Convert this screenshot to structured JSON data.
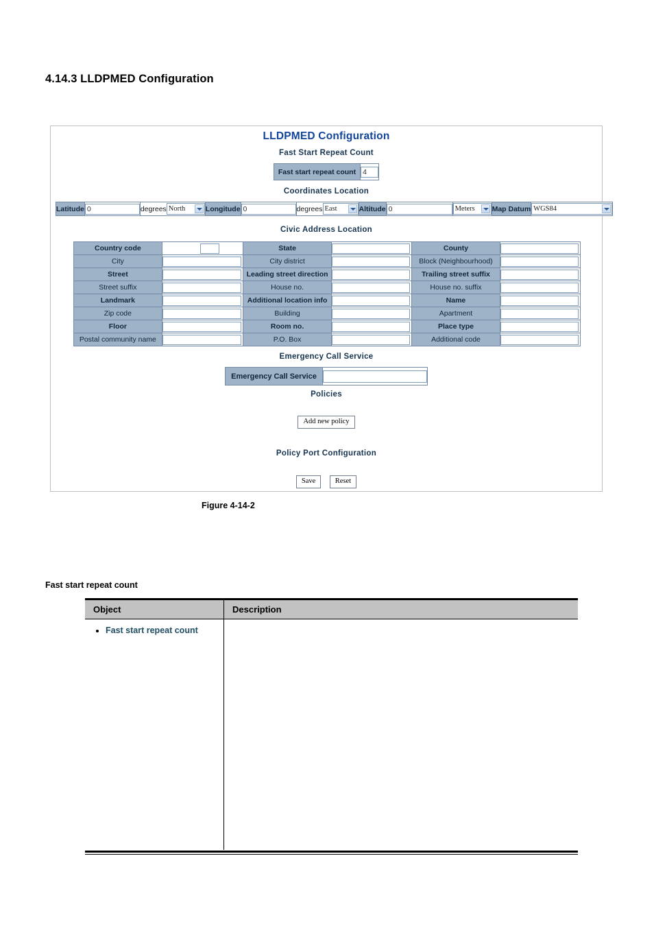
{
  "document": {
    "heading": "4.14.3 LLDPMED Configuration",
    "figure_caption": "Figure 4-14-2",
    "sub_heading": "Fast start repeat count"
  },
  "panel": {
    "title": "LLDPMED Configuration",
    "sections": {
      "fast_start": "Fast Start Repeat Count",
      "coordinates": "Coordinates Location",
      "civic": "Civic Address Location",
      "emergency": "Emergency Call Service",
      "policies": "Policies",
      "policy_port": "Policy Port Configuration"
    },
    "fast_start": {
      "label": "Fast start repeat count",
      "value": "4"
    },
    "coordinates": {
      "latitude_label": "Latitude",
      "latitude_value": "0",
      "latitude_units": "degrees",
      "latitude_direction": "North",
      "longitude_label": "Longitude",
      "longitude_value": "0",
      "longitude_units": "degrees",
      "longitude_direction": "East",
      "altitude_label": "Altitude",
      "altitude_value": "0",
      "altitude_units": "Meters",
      "map_datum_label": "Map Datum",
      "map_datum_value": "WGS84"
    },
    "civic_rows": [
      {
        "c1": "Country code",
        "v1": "",
        "c2": "State",
        "v2": "",
        "c3": "County",
        "v3": ""
      },
      {
        "c1": "City",
        "v1": "",
        "c2": "City district",
        "v2": "",
        "c3": "Block (Neighbourhood)",
        "v3": ""
      },
      {
        "c1": "Street",
        "v1": "",
        "c2": "Leading street direction",
        "v2": "",
        "c3": "Trailing street suffix",
        "v3": ""
      },
      {
        "c1": "Street suffix",
        "v1": "",
        "c2": "House no.",
        "v2": "",
        "c3": "House no. suffix",
        "v3": ""
      },
      {
        "c1": "Landmark",
        "v1": "",
        "c2": "Additional location info",
        "v2": "",
        "c3": "Name",
        "v3": ""
      },
      {
        "c1": "Zip code",
        "v1": "",
        "c2": "Building",
        "v2": "",
        "c3": "Apartment",
        "v3": ""
      },
      {
        "c1": "Floor",
        "v1": "",
        "c2": "Room no.",
        "v2": "",
        "c3": "Place type",
        "v3": ""
      },
      {
        "c1": "Postal community name",
        "v1": "",
        "c2": "P.O. Box",
        "v2": "",
        "c3": "Additional code",
        "v3": ""
      }
    ],
    "emergency": {
      "label": "Emergency Call Service",
      "value": ""
    },
    "buttons": {
      "add_new_policy": "Add new policy",
      "save": "Save",
      "reset": "Reset"
    }
  },
  "object_table": {
    "headers": {
      "object": "Object",
      "description": "Description"
    },
    "rows": [
      {
        "object": "Fast start repeat count",
        "description": ""
      }
    ]
  },
  "colors": {
    "panel_title": "#11449b",
    "section_heading": "#16334f",
    "label_cell_bg": "#9eb3c7",
    "table_header_bg": "#c2c2c2",
    "object_link": "#1f4e63"
  }
}
